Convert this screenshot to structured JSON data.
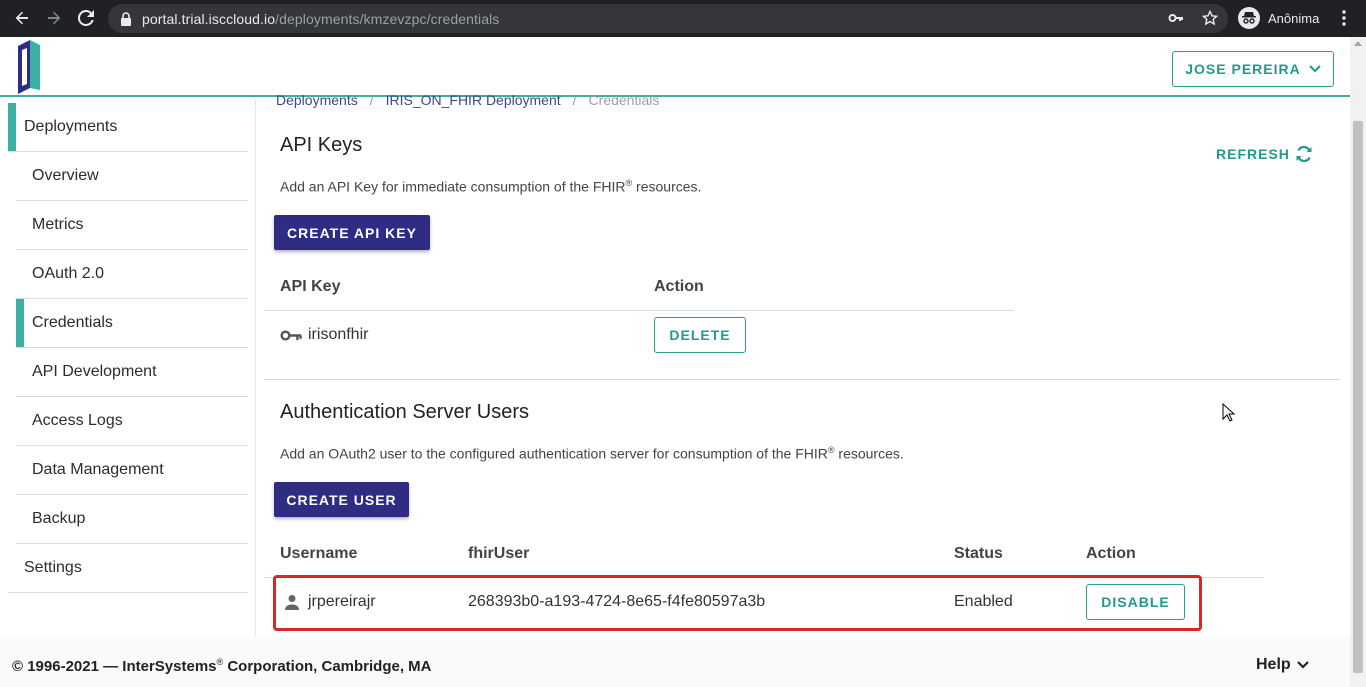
{
  "browser": {
    "url_host": "portal.trial.isccloud.io",
    "url_path": "/deployments/kmzevzpc/credentials",
    "profile_name": "Anônima"
  },
  "header": {
    "user_label": "JOSE PEREIRA"
  },
  "sidebar": {
    "items": [
      {
        "label": "Deployments"
      },
      {
        "label": "Overview"
      },
      {
        "label": "Metrics"
      },
      {
        "label": "OAuth 2.0"
      },
      {
        "label": "Credentials"
      },
      {
        "label": "API Development"
      },
      {
        "label": "Access Logs"
      },
      {
        "label": "Data Management"
      },
      {
        "label": "Backup"
      },
      {
        "label": "Settings"
      }
    ]
  },
  "breadcrumb": {
    "items": [
      "Deployments",
      "IRIS_ON_FHIR Deployment",
      "Credentials"
    ],
    "separator": "/"
  },
  "api_keys": {
    "title": "API Keys",
    "refresh_label": "REFRESH",
    "description_before": "Add an API Key for immediate consumption of the FHIR",
    "description_sup": "®",
    "description_after": " resources.",
    "create_label": "CREATE API KEY",
    "columns": [
      "API Key",
      "Action"
    ],
    "rows": [
      {
        "name": "irisonfhir",
        "action": "DELETE"
      }
    ]
  },
  "auth_users": {
    "title": "Authentication Server Users",
    "description_before": "Add an OAuth2 user to the configured authentication server for consumption of the FHIR",
    "description_sup": "®",
    "description_after": " resources.",
    "create_label": "CREATE USER",
    "columns": [
      "Username",
      "fhirUser",
      "Status",
      "Action"
    ],
    "rows": [
      {
        "username": "jrpereirajr",
        "fhir_user": "268393b0-a193-4724-8e65-f4fe80597a3b",
        "status": "Enabled",
        "action": "DISABLE"
      }
    ]
  },
  "footer": {
    "copyright_before": "© 1996-2021 — ",
    "company": "InterSystems",
    "sup": "®",
    "copyright_after": " Corporation, Cambridge, MA",
    "help_label": "Help"
  },
  "colors": {
    "accent_teal": "#3ab0a3",
    "primary_indigo": "#2e2d83",
    "highlight_red": "#d9262b",
    "chrome_dark": "#202124"
  },
  "icons": [
    "back-arrow-icon",
    "forward-arrow-icon",
    "reload-icon",
    "lock-icon",
    "key-icon",
    "star-icon",
    "incognito-icon",
    "kebab-menu-icon",
    "chevron-down-icon",
    "refresh-icon",
    "user-icon"
  ]
}
